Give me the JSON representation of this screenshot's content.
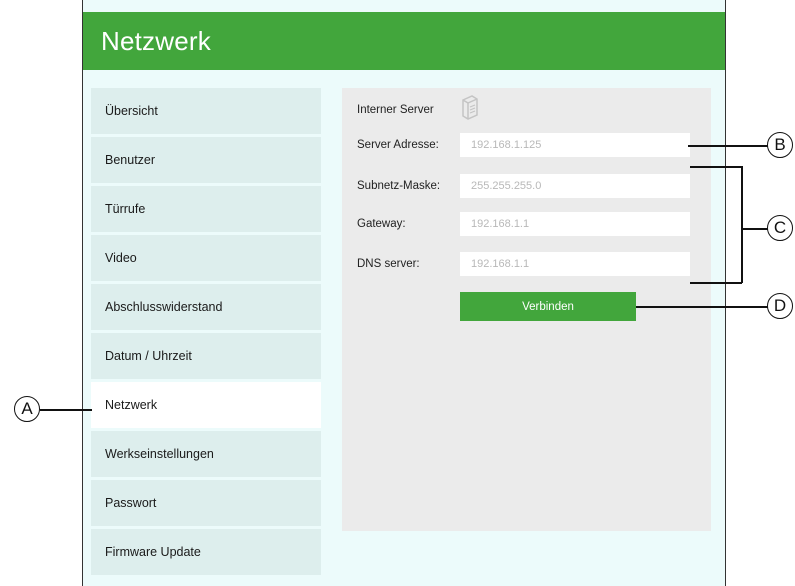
{
  "header": {
    "title": "Netzwerk"
  },
  "sidebar": {
    "items": [
      {
        "label": "Übersicht"
      },
      {
        "label": "Benutzer"
      },
      {
        "label": "Türrufe"
      },
      {
        "label": "Video"
      },
      {
        "label": "Abschlusswiderstand"
      },
      {
        "label": "Datum / Uhrzeit"
      },
      {
        "label": "Netzwerk",
        "active": true
      },
      {
        "label": "Werkseinstellungen"
      },
      {
        "label": "Passwort"
      },
      {
        "label": "Firmware Update"
      }
    ]
  },
  "panel": {
    "internal_server_label": "Interner Server",
    "server_icon": "server-document-icon",
    "fields": [
      {
        "label": "Server Adresse:",
        "value": "192.168.1.125"
      },
      {
        "label": "Subnetz-Maske:",
        "value": "255.255.255.0"
      },
      {
        "label": "Gateway:",
        "value": "192.168.1.1"
      },
      {
        "label": "DNS server:",
        "value": "192.168.1.1"
      }
    ],
    "connect_button": "Verbinden"
  },
  "callouts": {
    "a": "A",
    "b": "B",
    "c": "C",
    "d": "D"
  },
  "colors": {
    "accent": "#42a63c",
    "background": "#ecfbfb",
    "sidebar": "#ddeeed",
    "panel": "#ebebeb"
  }
}
